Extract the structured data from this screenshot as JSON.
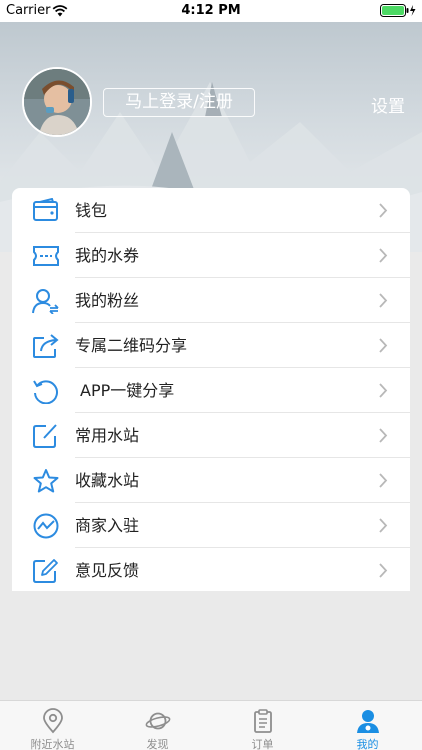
{
  "status_bar": {
    "carrier": "Carrier",
    "time": "4:12 PM"
  },
  "header": {
    "login_label": "马上登录/注册",
    "settings_label": "设置"
  },
  "menu": {
    "items": [
      {
        "label": "钱包",
        "icon": "wallet-icon"
      },
      {
        "label": "我的水券",
        "icon": "ticket-icon"
      },
      {
        "label": "我的粉丝",
        "icon": "fans-icon"
      },
      {
        "label": "专属二维码分享",
        "icon": "share-icon"
      },
      {
        "label": "APP一键分享",
        "icon": "refresh-icon"
      },
      {
        "label": "常用水站",
        "icon": "edit-square-icon"
      },
      {
        "label": "收藏水站",
        "icon": "star-icon"
      },
      {
        "label": "商家入驻",
        "icon": "trend-icon"
      },
      {
        "label": "意见反馈",
        "icon": "feedback-icon"
      }
    ]
  },
  "tabbar": {
    "tabs": [
      {
        "label": "附近水站",
        "icon": "location-pin-icon",
        "active": false
      },
      {
        "label": "发现",
        "icon": "planet-icon",
        "active": false
      },
      {
        "label": "订单",
        "icon": "clipboard-icon",
        "active": false
      },
      {
        "label": "我的",
        "icon": "user-icon",
        "active": true
      }
    ]
  },
  "colors": {
    "accent": "#1a8ee3",
    "icon_blue": "#2c8be0",
    "inactive": "#8e8e8e"
  }
}
